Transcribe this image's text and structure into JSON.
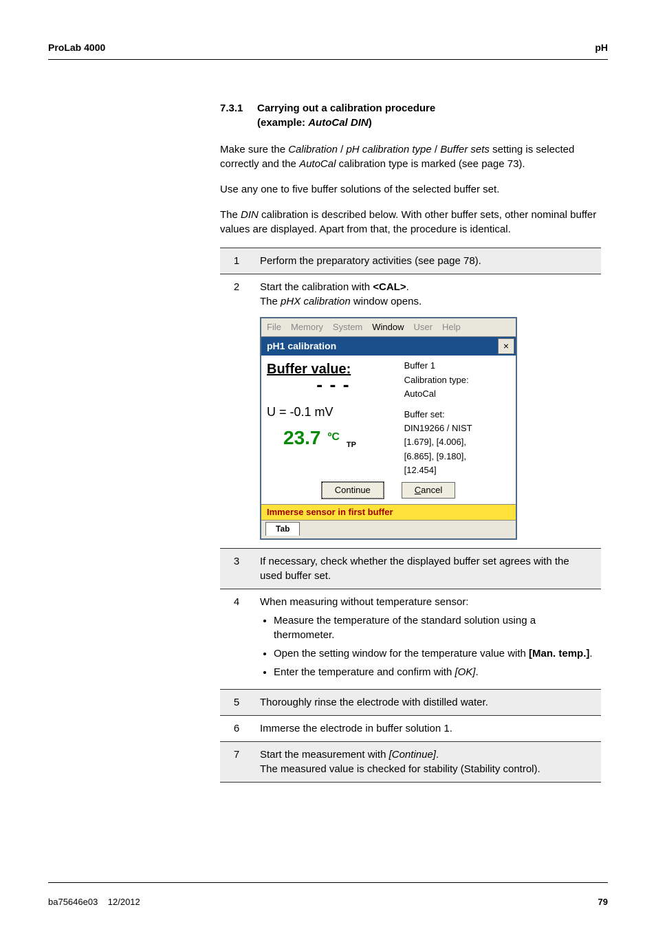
{
  "header": {
    "left": "ProLab 4000",
    "right": "pH"
  },
  "section": {
    "number": "7.3.1",
    "title_line1": "Carrying out a calibration procedure",
    "title_line2_prefix": "(example: ",
    "title_line2_em": "AutoCal DIN",
    "title_line2_suffix": ")"
  },
  "intro": {
    "p1_a": "Make sure the ",
    "p1_i1": "Calibration",
    "p1_b": " / ",
    "p1_i2": "pH calibration type",
    "p1_c": " / ",
    "p1_i3": "Buffer sets",
    "p1_d": " setting is selected correctly and the ",
    "p1_i4": "AutoCal",
    "p1_e": " calibration type is marked (see page 73).",
    "p2": "Use any one to five buffer solutions of the selected buffer set.",
    "p3_a": "The ",
    "p3_i1": "DIN",
    "p3_b": " calibration is described below. With other buffer sets, other nominal buffer values are displayed. Apart from that, the procedure is identical."
  },
  "steps": [
    {
      "n": "1",
      "text": "Perform the preparatory activities (see page 78)."
    },
    {
      "n": "2",
      "line1_a": "Start the calibration with ",
      "line1_b": "<CAL>",
      "line1_c": ".",
      "line2_a": "The ",
      "line2_i": "pHX calibration",
      "line2_b": " window opens."
    },
    {
      "n": "3",
      "text": "If necessary, check whether the displayed buffer set agrees with the used buffer set."
    },
    {
      "n": "4",
      "lead": "When measuring without temperature sensor:",
      "b1": "Measure the temperature of the standard solution using a thermometer.",
      "b2_a": "Open the setting window for the temperature value with ",
      "b2_b": "[Man. temp.]",
      "b2_c": ".",
      "b3_a": "Enter the temperature and confirm with ",
      "b3_i": "[OK]",
      "b3_b": "."
    },
    {
      "n": "5",
      "text": "Thoroughly rinse the electrode with distilled water."
    },
    {
      "n": "6",
      "text": "Immerse the electrode in buffer solution 1."
    },
    {
      "n": "7",
      "line_a": "Start the measurement with ",
      "line_i": "[Continue]",
      "line_b": ".",
      "line2": "The measured value is checked for stability (Stability control)."
    }
  ],
  "app": {
    "menu": {
      "file": "File",
      "memory": "Memory",
      "system": "System",
      "window": "Window",
      "user": "User",
      "help": "Help"
    },
    "title": "pH1 calibration",
    "close": "×",
    "left": {
      "buffer_label": "Buffer value:",
      "dashes": "---",
      "u_line": "U = -0.1 mV",
      "temp_value": "23.7",
      "temp_unit": "ºC",
      "tp": "TP"
    },
    "right": {
      "l1": "Buffer 1",
      "l2": "Calibration type:",
      "l3": "AutoCal",
      "l4": "Buffer set:",
      "l5": "DIN19266 / NIST",
      "l6": "[1.679], [4.006],",
      "l7": "[6.865], [9.180],",
      "l8": "[12.454]"
    },
    "buttons": {
      "continue": "Continue",
      "cancel": "Cancel"
    },
    "status": "Immerse sensor in first buffer",
    "tab": "Tab"
  },
  "footer": {
    "left_a": "ba75646e03",
    "left_b": "12/2012",
    "page": "79"
  }
}
